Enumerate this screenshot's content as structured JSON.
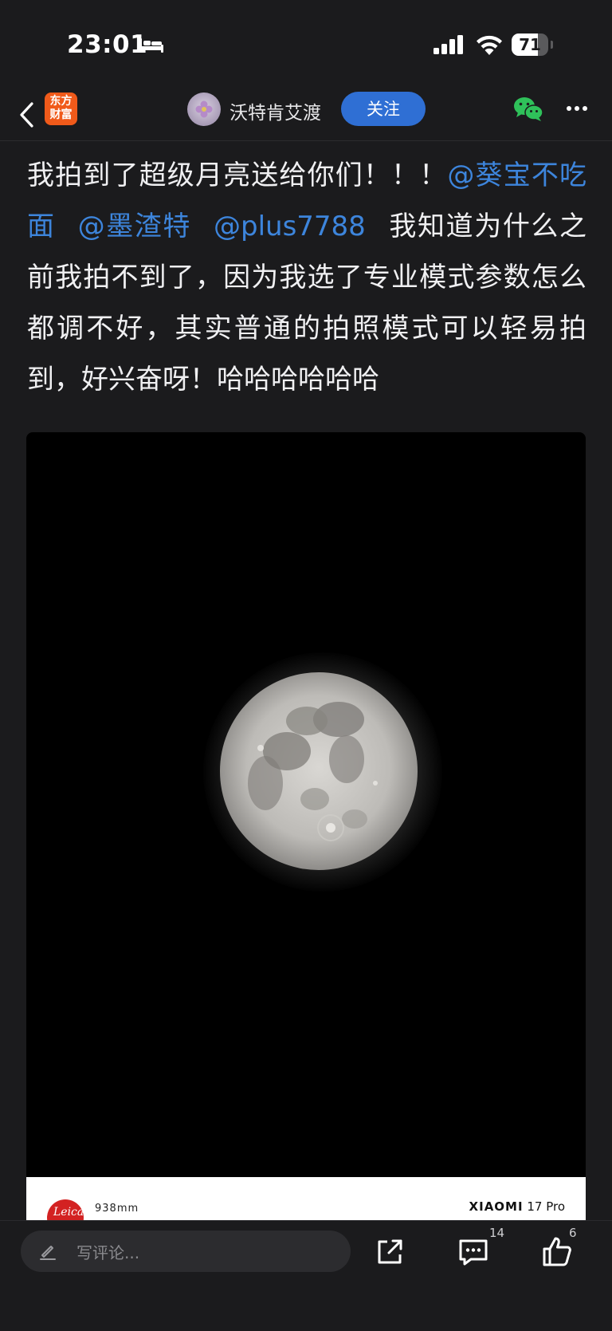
{
  "status_bar": {
    "time": "23:01",
    "battery_level": "71",
    "battery_fraction": 0.71,
    "icons": [
      "bed-icon",
      "signal-icon",
      "wifi-icon",
      "battery-icon"
    ]
  },
  "nav": {
    "app_logo_line1": "东方",
    "app_logo_line2": "财富",
    "author_name": "沃特肯艾渡",
    "follow_label": "关注",
    "icons": [
      "back-icon",
      "wechat-icon",
      "more-icon"
    ]
  },
  "post": {
    "text_part1": "我拍到了超级月亮送给你们！！！",
    "mention1": "@葵宝不吃面",
    "mention2": "@墨渣特",
    "mention3": "@plus7788",
    "text_part2": "我知道为什么之前我拍不到了，因为我选了专业模式参数怎么都调不好，其实普通的拍照模式可以轻易拍到，好兴奋呀！哈哈哈哈哈哈"
  },
  "photo": {
    "subject": "full-moon",
    "watermark_brand": "Leica",
    "focal_length": "938mm",
    "device_brand": "XIAOMI",
    "device_model": "17 Pro"
  },
  "bottom_bar": {
    "comment_placeholder": "写评论...",
    "comment_count": "14",
    "like_count": "6",
    "icons": [
      "pencil-icon",
      "share-icon",
      "comment-icon",
      "like-icon"
    ]
  },
  "colors": {
    "background": "#1b1b1d",
    "accent_blue": "#2f6fd4",
    "mention_blue": "#3d85dc",
    "app_logo_orange": "#f05a1a",
    "leica_red": "#d32222"
  }
}
